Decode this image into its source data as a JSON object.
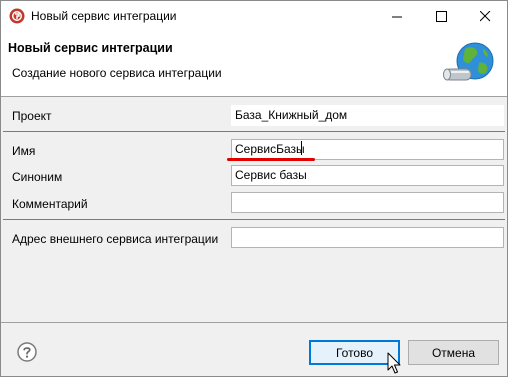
{
  "window": {
    "title": "Новый сервис интеграции",
    "icon": "app-logo-icon"
  },
  "banner": {
    "title": "Новый сервис интеграции",
    "subtitle": "Создание нового сервиса интеграции",
    "icon": "globe-connector-icon"
  },
  "form": {
    "project_label": "Проект",
    "project_value": "База_Книжный_дом",
    "name_label": "Имя",
    "name_value": "СервисБазы",
    "synonym_label": "Синоним",
    "synonym_value": "Сервис базы",
    "comment_label": "Комментарий",
    "comment_value": "",
    "address_label": "Адрес внешнего сервиса интеграции",
    "address_value": ""
  },
  "footer": {
    "help_icon": "help-icon",
    "ok_label": "Готово",
    "cancel_label": "Отмена"
  },
  "colors": {
    "accent": "#0078d7",
    "highlight_underline": "#e00000",
    "dialog_bg": "#f0f0f0"
  }
}
